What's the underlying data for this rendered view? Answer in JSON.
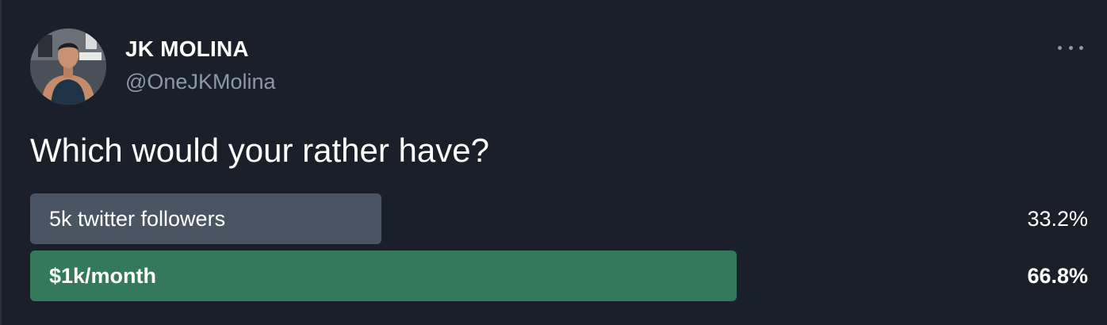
{
  "author": {
    "display_name": "JK MOLINA",
    "handle": "@OneJKMolina",
    "avatar_icon": "profile-photo"
  },
  "more_icon": "ellipsis-icon",
  "tweet": {
    "text": "Which would your rather have?"
  },
  "poll": {
    "options": [
      {
        "label": "5k twitter followers",
        "percent_text": "33.2%",
        "percent": 33.2,
        "winner": false,
        "bar_color": "#4a5564"
      },
      {
        "label": "$1k/month",
        "percent_text": "66.8%",
        "percent": 66.8,
        "winner": true,
        "bar_color": "#35795c"
      }
    ]
  },
  "colors": {
    "background": "#1a1f2a",
    "text_primary": "#ffffff",
    "text_secondary": "#8b98a5"
  }
}
